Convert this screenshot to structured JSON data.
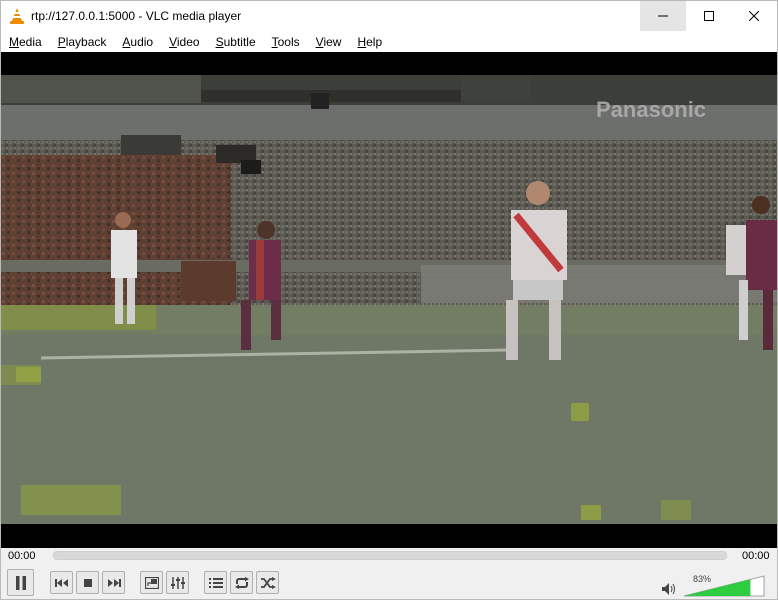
{
  "window": {
    "title": "rtp://127.0.0.1:5000 - VLC media player"
  },
  "menu": [
    {
      "mnemonic": "M",
      "rest": "edia"
    },
    {
      "mnemonic": "P",
      "rest": "layback"
    },
    {
      "mnemonic": "A",
      "rest": "udio"
    },
    {
      "mnemonic": "V",
      "rest": "ideo"
    },
    {
      "mnemonic": "S",
      "rest": "ubtitle"
    },
    {
      "mnemonic": "T",
      "rest": "ools"
    },
    {
      "mnemonic": "V",
      "rest": "iew"
    },
    {
      "mnemonic": "H",
      "rest": "elp"
    }
  ],
  "video": {
    "overlay_text": "Panasonic"
  },
  "seek": {
    "elapsed": "00:00",
    "total": "00:00",
    "progress": 0
  },
  "volume": {
    "label": "83%",
    "level": 0.83,
    "color": "#2ecc40"
  },
  "icons": {
    "app": "vlc-cone-icon",
    "pause": "pause-icon",
    "previous": "previous-icon",
    "stop": "stop-icon",
    "next": "next-icon",
    "fullscreen": "fullscreen-icon",
    "extended": "equalizer-icon",
    "playlist": "playlist-icon",
    "loop": "loop-icon",
    "random": "shuffle-icon",
    "speaker": "speaker-icon"
  }
}
